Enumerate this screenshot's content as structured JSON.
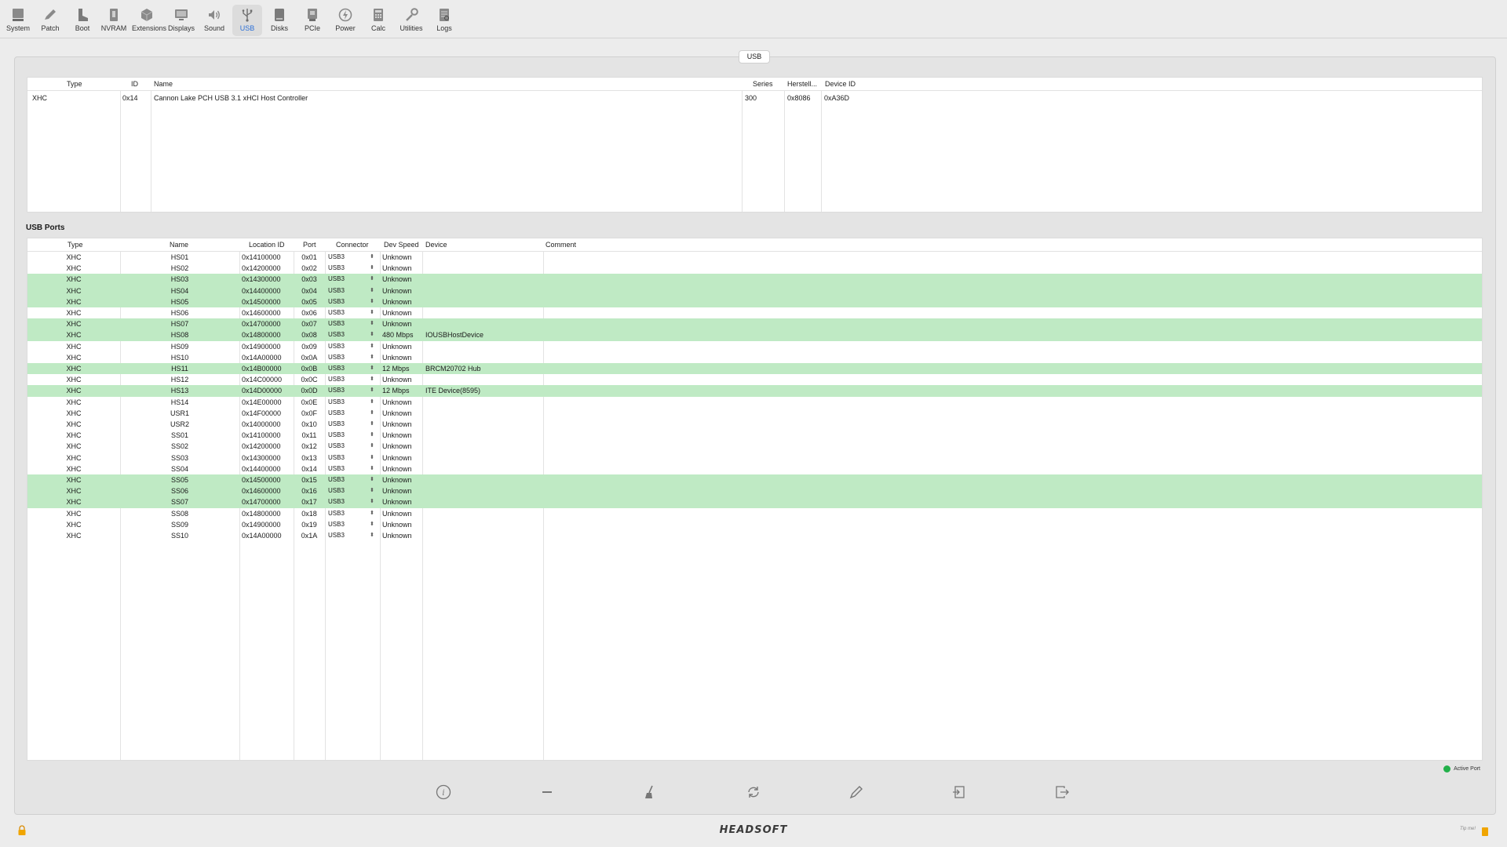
{
  "toolbar": {
    "items": [
      {
        "label": "System",
        "icon": "system-icon"
      },
      {
        "label": "Patch",
        "icon": "patch-icon"
      },
      {
        "label": "Boot",
        "icon": "boot-icon"
      },
      {
        "label": "NVRAM",
        "icon": "nvram-icon"
      },
      {
        "label": "Extensions",
        "icon": "extensions-icon"
      },
      {
        "label": "Displays",
        "icon": "displays-icon"
      },
      {
        "label": "Sound",
        "icon": "sound-icon"
      },
      {
        "label": "USB",
        "icon": "usb-icon",
        "active": true
      },
      {
        "label": "Disks",
        "icon": "disks-icon"
      },
      {
        "label": "PCIe",
        "icon": "pcie-icon"
      },
      {
        "label": "Power",
        "icon": "power-icon"
      },
      {
        "label": "Calc",
        "icon": "calc-icon"
      },
      {
        "label": "Utilities",
        "icon": "utilities-icon"
      },
      {
        "label": "Logs",
        "icon": "logs-icon"
      }
    ]
  },
  "panel": {
    "tab_label": "USB"
  },
  "controllers": {
    "headers": {
      "type": "Type",
      "id": "ID",
      "name": "Name",
      "series": "Series",
      "hersteller": "Herstell...",
      "device_id": "Device ID"
    },
    "rows": [
      {
        "type": "XHC",
        "id": "0x14",
        "name": "Cannon Lake PCH USB 3.1 xHCI Host Controller",
        "series": "300",
        "hersteller": "0x8086",
        "device_id": "0xA36D"
      }
    ]
  },
  "ports": {
    "title": "USB Ports",
    "headers": {
      "type": "Type",
      "name": "Name",
      "location": "Location ID",
      "port": "Port",
      "connector": "Connector",
      "speed": "Dev Speed",
      "device": "Device",
      "comment": "Comment"
    },
    "rows": [
      {
        "type": "XHC",
        "name": "HS01",
        "location": "0x14100000",
        "port": "0x01",
        "connector": "USB3",
        "speed": "Unknown",
        "device": "",
        "comment": "",
        "active": false
      },
      {
        "type": "XHC",
        "name": "HS02",
        "location": "0x14200000",
        "port": "0x02",
        "connector": "USB3",
        "speed": "Unknown",
        "device": "",
        "comment": "",
        "active": false
      },
      {
        "type": "XHC",
        "name": "HS03",
        "location": "0x14300000",
        "port": "0x03",
        "connector": "USB3",
        "speed": "Unknown",
        "device": "",
        "comment": "",
        "active": true
      },
      {
        "type": "XHC",
        "name": "HS04",
        "location": "0x14400000",
        "port": "0x04",
        "connector": "USB3",
        "speed": "Unknown",
        "device": "",
        "comment": "",
        "active": true
      },
      {
        "type": "XHC",
        "name": "HS05",
        "location": "0x14500000",
        "port": "0x05",
        "connector": "USB3",
        "speed": "Unknown",
        "device": "",
        "comment": "",
        "active": true
      },
      {
        "type": "XHC",
        "name": "HS06",
        "location": "0x14600000",
        "port": "0x06",
        "connector": "USB3",
        "speed": "Unknown",
        "device": "",
        "comment": "",
        "active": false
      },
      {
        "type": "XHC",
        "name": "HS07",
        "location": "0x14700000",
        "port": "0x07",
        "connector": "USB3",
        "speed": "Unknown",
        "device": "",
        "comment": "",
        "active": true
      },
      {
        "type": "XHC",
        "name": "HS08",
        "location": "0x14800000",
        "port": "0x08",
        "connector": "USB3",
        "speed": "480 Mbps",
        "device": "IOUSBHostDevice",
        "comment": "",
        "active": true
      },
      {
        "type": "XHC",
        "name": "HS09",
        "location": "0x14900000",
        "port": "0x09",
        "connector": "USB3",
        "speed": "Unknown",
        "device": "",
        "comment": "",
        "active": false
      },
      {
        "type": "XHC",
        "name": "HS10",
        "location": "0x14A00000",
        "port": "0x0A",
        "connector": "USB3",
        "speed": "Unknown",
        "device": "",
        "comment": "",
        "active": false
      },
      {
        "type": "XHC",
        "name": "HS11",
        "location": "0x14B00000",
        "port": "0x0B",
        "connector": "USB3",
        "speed": "12 Mbps",
        "device": "BRCM20702 Hub",
        "comment": "",
        "active": true
      },
      {
        "type": "XHC",
        "name": "HS12",
        "location": "0x14C00000",
        "port": "0x0C",
        "connector": "USB3",
        "speed": "Unknown",
        "device": "",
        "comment": "",
        "active": false
      },
      {
        "type": "XHC",
        "name": "HS13",
        "location": "0x14D00000",
        "port": "0x0D",
        "connector": "USB3",
        "speed": "12 Mbps",
        "device": "ITE Device(8595)",
        "comment": "",
        "active": true
      },
      {
        "type": "XHC",
        "name": "HS14",
        "location": "0x14E00000",
        "port": "0x0E",
        "connector": "USB3",
        "speed": "Unknown",
        "device": "",
        "comment": "",
        "active": false
      },
      {
        "type": "XHC",
        "name": "USR1",
        "location": "0x14F00000",
        "port": "0x0F",
        "connector": "USB3",
        "speed": "Unknown",
        "device": "",
        "comment": "",
        "active": false
      },
      {
        "type": "XHC",
        "name": "USR2",
        "location": "0x14000000",
        "port": "0x10",
        "connector": "USB3",
        "speed": "Unknown",
        "device": "",
        "comment": "",
        "active": false
      },
      {
        "type": "XHC",
        "name": "SS01",
        "location": "0x14100000",
        "port": "0x11",
        "connector": "USB3",
        "speed": "Unknown",
        "device": "",
        "comment": "",
        "active": false
      },
      {
        "type": "XHC",
        "name": "SS02",
        "location": "0x14200000",
        "port": "0x12",
        "connector": "USB3",
        "speed": "Unknown",
        "device": "",
        "comment": "",
        "active": false
      },
      {
        "type": "XHC",
        "name": "SS03",
        "location": "0x14300000",
        "port": "0x13",
        "connector": "USB3",
        "speed": "Unknown",
        "device": "",
        "comment": "",
        "active": false
      },
      {
        "type": "XHC",
        "name": "SS04",
        "location": "0x14400000",
        "port": "0x14",
        "connector": "USB3",
        "speed": "Unknown",
        "device": "",
        "comment": "",
        "active": false
      },
      {
        "type": "XHC",
        "name": "SS05",
        "location": "0x14500000",
        "port": "0x15",
        "connector": "USB3",
        "speed": "Unknown",
        "device": "",
        "comment": "",
        "active": true
      },
      {
        "type": "XHC",
        "name": "SS06",
        "location": "0x14600000",
        "port": "0x16",
        "connector": "USB3",
        "speed": "Unknown",
        "device": "",
        "comment": "",
        "active": true
      },
      {
        "type": "XHC",
        "name": "SS07",
        "location": "0x14700000",
        "port": "0x17",
        "connector": "USB3",
        "speed": "Unknown",
        "device": "",
        "comment": "",
        "active": true
      },
      {
        "type": "XHC",
        "name": "SS08",
        "location": "0x14800000",
        "port": "0x18",
        "connector": "USB3",
        "speed": "Unknown",
        "device": "",
        "comment": "",
        "active": false
      },
      {
        "type": "XHC",
        "name": "SS09",
        "location": "0x14900000",
        "port": "0x19",
        "connector": "USB3",
        "speed": "Unknown",
        "device": "",
        "comment": "",
        "active": false
      },
      {
        "type": "XHC",
        "name": "SS10",
        "location": "0x14A00000",
        "port": "0x1A",
        "connector": "USB3",
        "speed": "Unknown",
        "device": "",
        "comment": "",
        "active": false
      }
    ]
  },
  "legend": {
    "label": "Active Port",
    "color": "#22b04a"
  },
  "colors": {
    "active_row": "#bfeac4",
    "accent": "#2b6fd8"
  },
  "actions": [
    {
      "icon": "info-icon"
    },
    {
      "icon": "minus-icon"
    },
    {
      "icon": "broom-icon"
    },
    {
      "icon": "refresh-icon"
    },
    {
      "icon": "pencil-icon"
    },
    {
      "icon": "import-icon"
    },
    {
      "icon": "export-icon"
    }
  ],
  "footer": {
    "logo": "HEADSOFT",
    "tip_jar": "Tip me!"
  }
}
